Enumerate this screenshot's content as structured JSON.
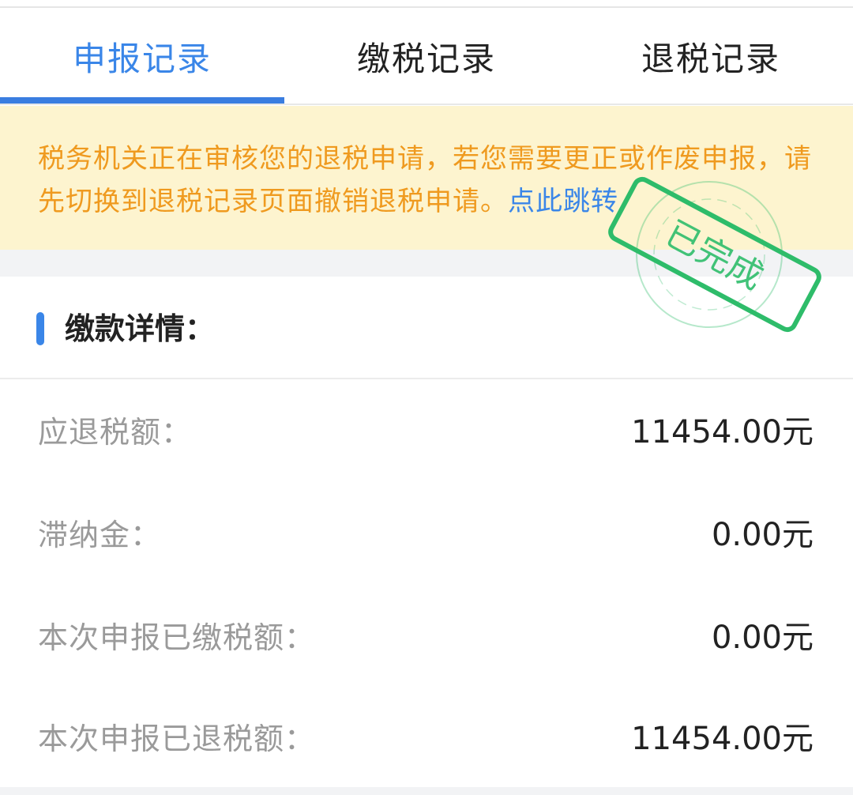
{
  "tabs": [
    {
      "label": "申报记录",
      "active": true
    },
    {
      "label": "缴税记录",
      "active": false
    },
    {
      "label": "退税记录",
      "active": false
    }
  ],
  "notice": {
    "text": "税务机关正在审核您的退税申请，若您需要更正或作废申报，请先切换到退税记录页面撤销退税申请。",
    "link": "点此跳转"
  },
  "section": {
    "title": "缴款详情："
  },
  "rows": [
    {
      "label": "应退税额：",
      "value": "11454.00元"
    },
    {
      "label": "滞纳金：",
      "value": "0.00元"
    },
    {
      "label": "本次申报已缴税额：",
      "value": "0.00元"
    },
    {
      "label": "本次申报已退税额：",
      "value": "11454.00元"
    }
  ],
  "stamp": {
    "text": "已完成",
    "color": "#2ebc6a"
  },
  "colors": {
    "accent": "#3a86e8",
    "notice_bg": "#fdf4cf",
    "notice_text": "#ef9a1f",
    "label_gray": "#9a9a9a"
  }
}
